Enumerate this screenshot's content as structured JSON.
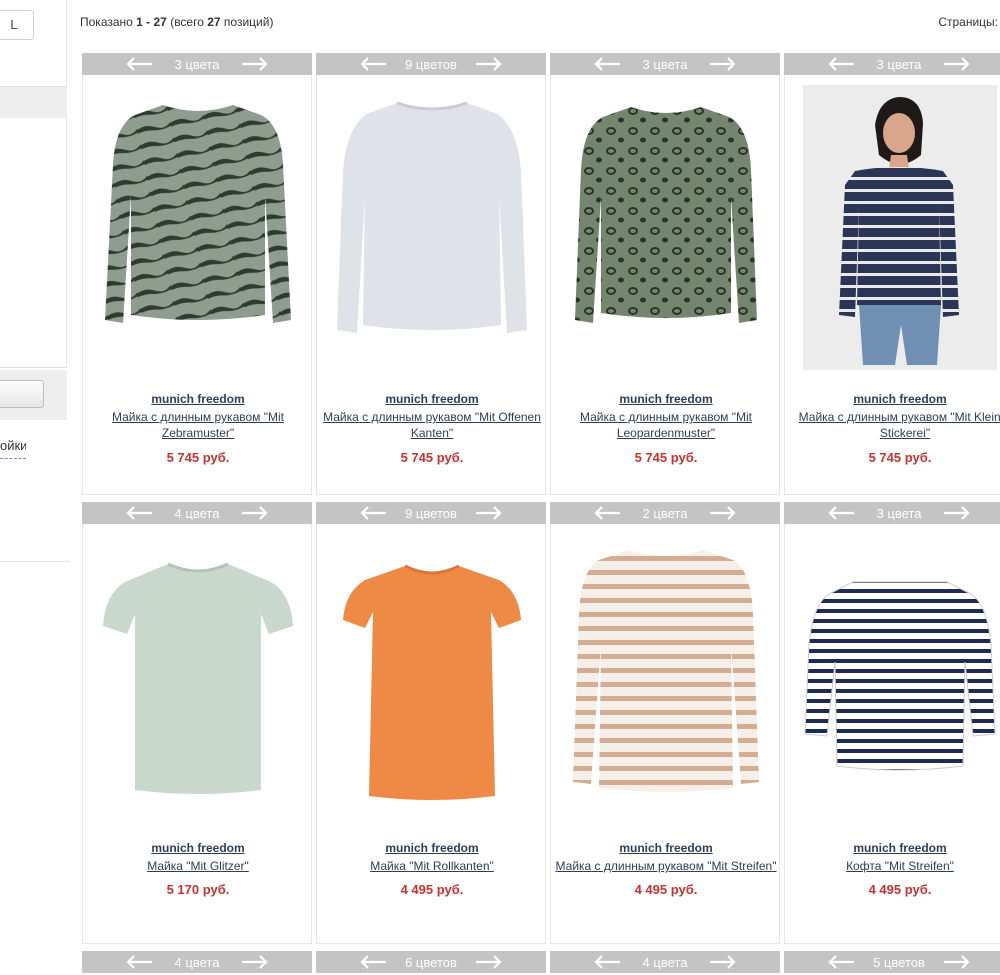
{
  "filter": {
    "size_value": "L",
    "settings_link_fragment": "ойки"
  },
  "listing": {
    "summary": {
      "prefix": "Показано ",
      "range": "1 - 27",
      "middle": " (всего ",
      "total": "27",
      "suffix": " позиций)"
    },
    "pages_label": "Страницы:"
  },
  "products": [
    {
      "colors": "3 цвета",
      "brand": "munich freedom",
      "title": "Майка с длинным рукавом \"Mit Zebramuster\"",
      "price": "5 745 руб.",
      "icon": "zebra-longsleeve-top"
    },
    {
      "colors": "9 цветов",
      "brand": "munich freedom",
      "title": "Майка с длинным рукавом \"Mit Offenen Kanten\"",
      "price": "5 745 руб.",
      "icon": "grey-longsleeve-top"
    },
    {
      "colors": "3 цвета",
      "brand": "munich freedom",
      "title": "Майка с длинным рукавом \"Mit Leopardenmuster\"",
      "price": "5 745 руб.",
      "icon": "leopard-longsleeve-top"
    },
    {
      "colors": "3 цвета",
      "brand": "munich freedom",
      "title": "Майка с длинным рукавом \"Mit Kleiner Stickerei\"",
      "price": "5 745 руб.",
      "icon": "model-striped-top"
    },
    {
      "colors": "4 цвета",
      "brand": "munich freedom",
      "title": "Майка \"Mit Glitzer\"",
      "price": "5 170 руб.",
      "icon": "mint-tshirt"
    },
    {
      "colors": "9 цветов",
      "brand": "munich freedom",
      "title": "Майка \"Mit Rollkanten\"",
      "price": "4 495 руб.",
      "icon": "orange-tshirt"
    },
    {
      "colors": "2 цвета",
      "brand": "munich freedom",
      "title": "Майка с длинным рукавом \"Mit Streifen\"",
      "price": "4 495 руб.",
      "icon": "beige-striped-longsleeve"
    },
    {
      "colors": "3 цвета",
      "brand": "munich freedom",
      "title": "Кофта \"Mit Streifen\"",
      "price": "4 495 руб.",
      "icon": "navy-striped-top"
    },
    {
      "colors": "4 цвета"
    },
    {
      "colors": "6 цветов"
    },
    {
      "colors": "4 цвета"
    },
    {
      "colors": "5 цветов"
    }
  ],
  "colors": {
    "price": "#c8322f",
    "link": "#2d3f57",
    "header_band": "#c4c4c4"
  }
}
